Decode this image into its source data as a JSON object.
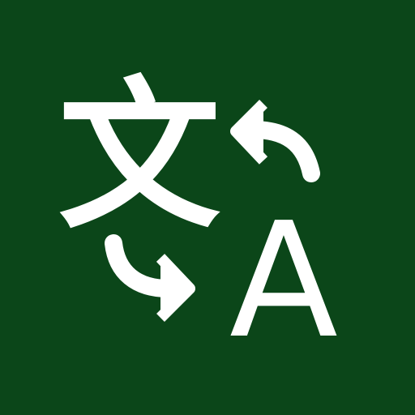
{
  "icon": {
    "name": "translate-app-icon",
    "background_color": "#0B4619",
    "foreground_color": "#FFFFFF",
    "source_glyph": "文",
    "target_glyph": "A",
    "arrow_top": "curved-arrow-left-icon",
    "arrow_bottom": "curved-arrow-right-icon"
  }
}
